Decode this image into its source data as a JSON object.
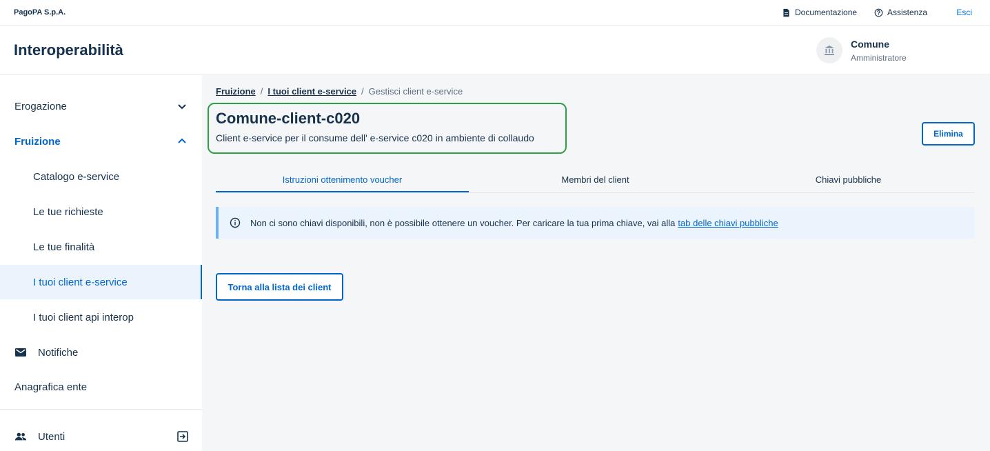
{
  "topbar": {
    "brand": "PagoPA S.p.A.",
    "documentation": "Documentazione",
    "assistance": "Assistenza",
    "logout": "Esci"
  },
  "header": {
    "app_title": "Interoperabilità",
    "party_name": "Comune",
    "party_role": "Amministratore"
  },
  "sidebar": {
    "items": [
      {
        "label": "Erogazione",
        "icon": "chevron-down-icon"
      },
      {
        "label": "Fruizione",
        "icon": "chevron-up-icon"
      },
      {
        "label": "Catalogo e-service"
      },
      {
        "label": "Le tue richieste"
      },
      {
        "label": "Le tue finalità"
      },
      {
        "label": "I tuoi client e-service"
      },
      {
        "label": "I tuoi client api interop"
      },
      {
        "label": "Notifiche",
        "icon": "mail-icon"
      },
      {
        "label": "Anagrafica ente"
      },
      {
        "label": "Utenti",
        "icon": "users-icon"
      }
    ]
  },
  "breadcrumb": {
    "items": [
      "Fruizione",
      "I tuoi client e-service",
      "Gestisci client e-service"
    ]
  },
  "page": {
    "title": "Comune-client-c020",
    "subtitle": "Client e-service per il consume dell' e-service c020 in ambiente di collaudo",
    "delete_button": "Elimina",
    "back_button": "Torna alla lista dei client"
  },
  "tabs": [
    {
      "label": "Istruzioni ottenimento voucher",
      "active": true
    },
    {
      "label": "Membri del client",
      "active": false
    },
    {
      "label": "Chiavi pubbliche",
      "active": false
    }
  ],
  "alert": {
    "text": "Non ci sono chiavi disponibili, non è possibile ottenere un voucher. Per caricare la tua prima chiave, vai alla",
    "link": "tab delle chiavi pubbliche"
  },
  "colors": {
    "accent": "#0066cc",
    "highlight_border": "#2ea043",
    "text": "#17324d"
  }
}
